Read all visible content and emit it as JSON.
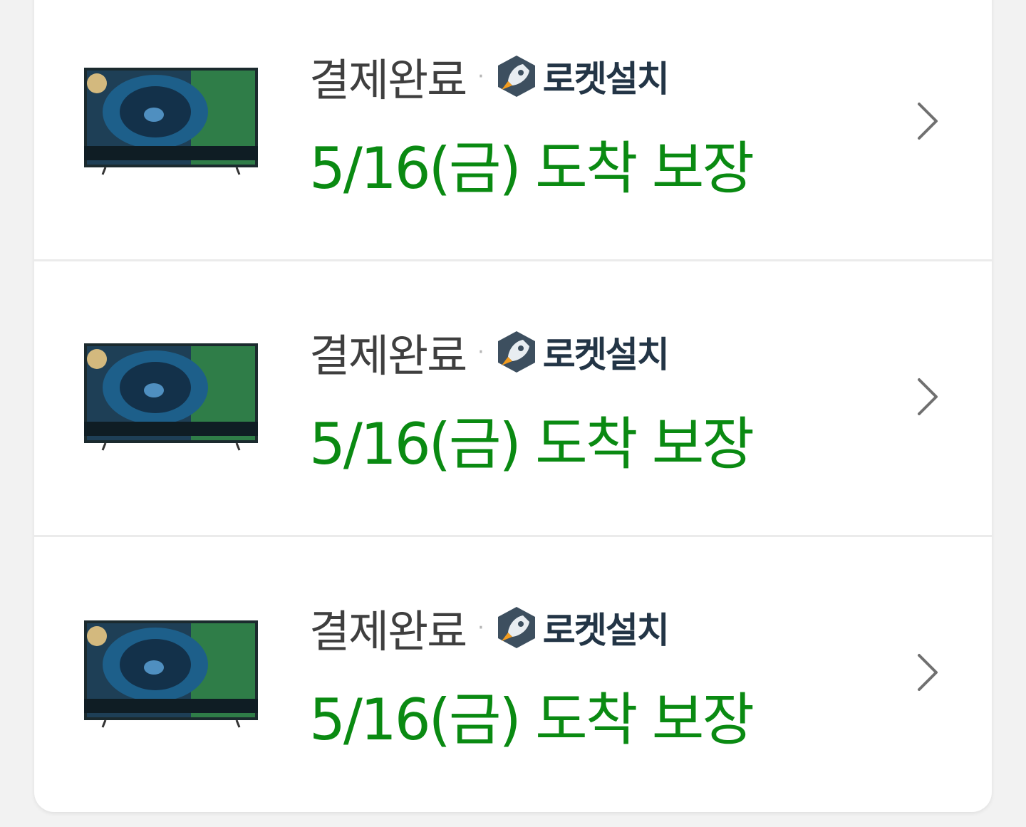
{
  "orders": [
    {
      "status": "결제완료",
      "separator": "·",
      "rocket_label": "로켓설치",
      "arrival": "5/16(금) 도착 보장",
      "product_image": "tv-product-image",
      "chevron_icon": "chevron-right-icon"
    },
    {
      "status": "결제완료",
      "separator": "·",
      "rocket_label": "로켓설치",
      "arrival": "5/16(금) 도착 보장",
      "product_image": "tv-product-image",
      "chevron_icon": "chevron-right-icon"
    },
    {
      "status": "결제완료",
      "separator": "·",
      "rocket_label": "로켓설치",
      "arrival": "5/16(금) 도착 보장",
      "product_image": "tv-product-image",
      "chevron_icon": "chevron-right-icon"
    }
  ],
  "colors": {
    "arrival_green": "#0a8a12",
    "status_gray": "#3f3f3f",
    "rocket_text": "#233546"
  }
}
